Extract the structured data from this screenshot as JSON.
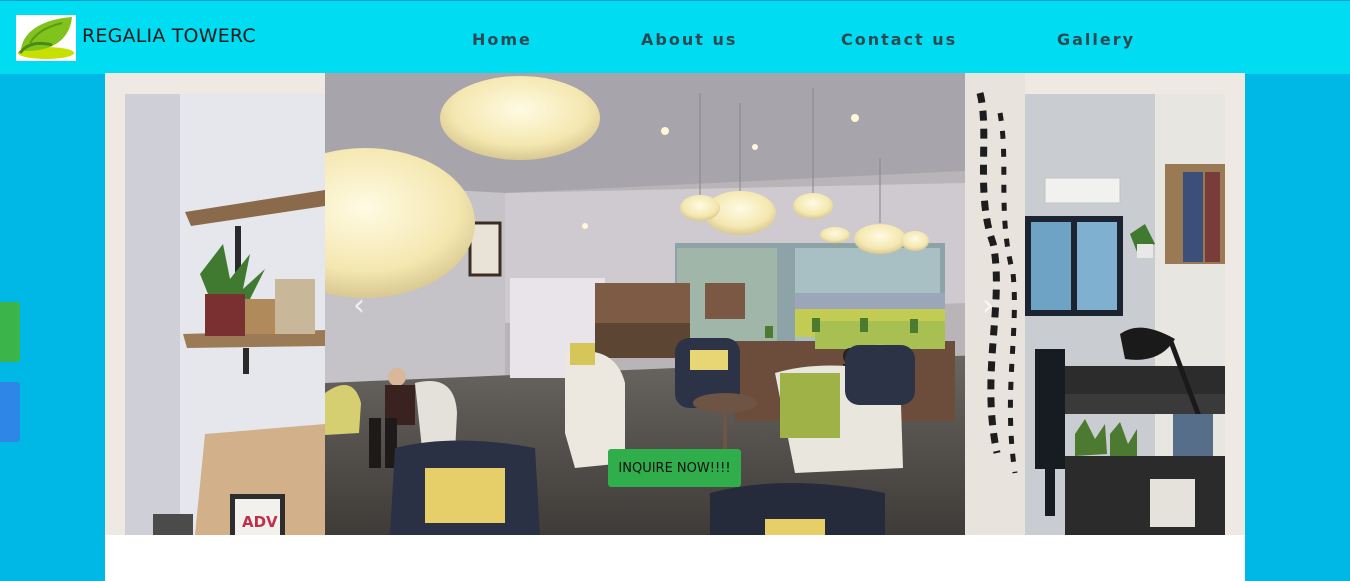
{
  "header": {
    "brand": "REGALIA TOWERC",
    "logo_icon": "leaf-logo",
    "nav": [
      {
        "label": "Home"
      },
      {
        "label": "About us"
      },
      {
        "label": "Contact us"
      },
      {
        "label": "Gallery"
      }
    ]
  },
  "carousel": {
    "slides": [
      {
        "name": "shelf-office-photo"
      },
      {
        "name": "cafe-lounge-photo"
      },
      {
        "name": "workspace-photo"
      }
    ],
    "prev_icon": "chevron-left-icon",
    "next_icon": "chevron-right-icon",
    "cta_label": "INQUIRE NOW!!!!"
  },
  "social": {
    "buttons": [
      "share-green-button",
      "share-blue-button"
    ]
  },
  "colors": {
    "nav_bg": "#00dcf1",
    "page_bg": "#00b8e6",
    "cta_bg": "#2fae4b"
  }
}
